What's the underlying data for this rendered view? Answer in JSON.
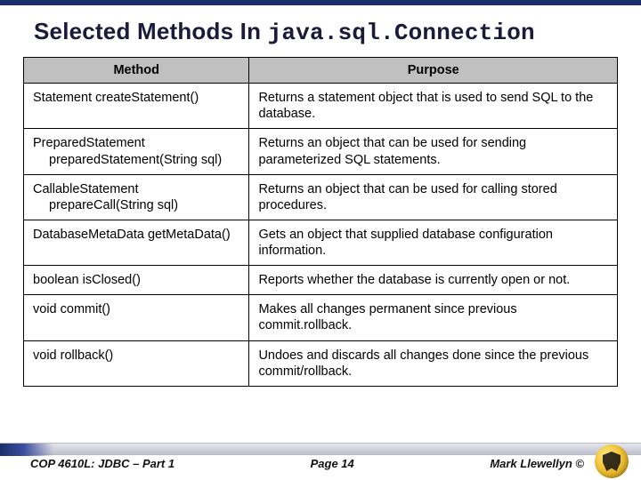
{
  "title_prefix": "Selected Methods In ",
  "title_code": "java.sql.Connection",
  "headers": {
    "method": "Method",
    "purpose": "Purpose"
  },
  "rows": [
    {
      "method_line1": "Statement  createStatement()",
      "method_line2": "",
      "purpose": "Returns a statement object that is used to send SQL to the database."
    },
    {
      "method_line1": "PreparedStatement",
      "method_line2": "preparedStatement(String sql)",
      "purpose": "Returns an object that can be used for sending parameterized SQL statements."
    },
    {
      "method_line1": "CallableStatement",
      "method_line2": "prepareCall(String sql)",
      "purpose": "Returns an object that can be used for calling stored procedures."
    },
    {
      "method_line1": "DatabaseMetaData  getMetaData()",
      "method_line2": "",
      "purpose": "Gets an object that supplied database configuration information."
    },
    {
      "method_line1": "boolean  isClosed()",
      "method_line2": "",
      "purpose": "Reports whether the database is currently open or not."
    },
    {
      "method_line1": "void commit()",
      "method_line2": "",
      "purpose": "Makes all changes permanent since previous commit.rollback."
    },
    {
      "method_line1": "void rollback()",
      "method_line2": "",
      "purpose": "Undoes and discards all changes done since the previous commit/rollback."
    }
  ],
  "footer": {
    "course": "COP 4610L: JDBC – Part 1",
    "page": "Page 14",
    "author": "Mark Llewellyn ©"
  }
}
